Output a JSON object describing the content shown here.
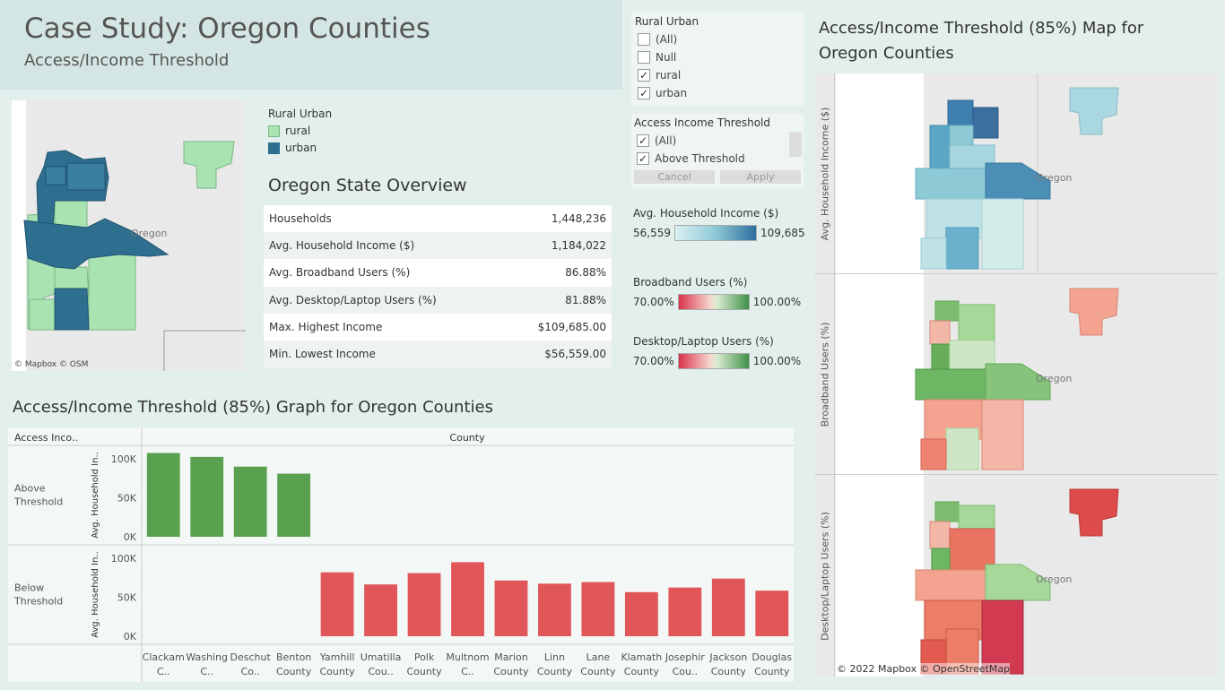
{
  "header": {
    "title": "Case Study: Oregon Counties",
    "subtitle": "Access/Income Threshold"
  },
  "small_map": {
    "state_label": "Oregon",
    "attribution": "© Mapbox  © OSM"
  },
  "legend": {
    "title": "Rural Urban",
    "items": [
      {
        "label": "rural",
        "color": "#a8e3b1"
      },
      {
        "label": "urban",
        "color": "#2e6e8e"
      }
    ]
  },
  "overview": {
    "title": "Oregon State Overview",
    "rows": [
      {
        "label": "Households",
        "value": "1,448,236"
      },
      {
        "label": "Avg. Household Income ($)",
        "value": "1,184,022"
      },
      {
        "label": "Avg. Broadband Users (%)",
        "value": "86.88%"
      },
      {
        "label": "Avg. Desktop/Laptop Users (%)",
        "value": "81.88%"
      },
      {
        "label": "Max. Highest Income",
        "value": "$109,685.00"
      },
      {
        "label": "Min. Lowest Income",
        "value": "$56,559.00"
      }
    ]
  },
  "filter_rural": {
    "title": "Rural Urban",
    "items": [
      {
        "label": "(All)",
        "checked": false
      },
      {
        "label": "Null",
        "checked": false
      },
      {
        "label": "rural",
        "checked": true
      },
      {
        "label": "urban",
        "checked": true
      }
    ]
  },
  "filter_access": {
    "title": "Access Income Threshold",
    "items": [
      {
        "label": "(All)",
        "checked": true
      },
      {
        "label": "Above Threshold",
        "checked": true
      }
    ],
    "cancel_label": "Cancel",
    "apply_label": "Apply"
  },
  "color_legends": {
    "income": {
      "title": "Avg. Household Income ($)",
      "min": "56,559",
      "max": "109,685"
    },
    "broadband": {
      "title": "Broadband Users (%)",
      "min": "70.00%",
      "max": "100.00%"
    },
    "desktop": {
      "title": "Desktop/Laptop Users (%)",
      "min": "70.00%",
      "max": "100.00%"
    }
  },
  "right_panel": {
    "title": "Access/Income Threshold (85%) Map for Oregon Counties",
    "panels": [
      {
        "axis": "Avg. Household Income ($)",
        "state_label": "Oregon"
      },
      {
        "axis": "Broadband Users (%)",
        "state_label": "Oregon"
      },
      {
        "axis": "Desktop/Laptop Users (%)",
        "state_label": "Oregon"
      }
    ],
    "attribution": "© 2022 Mapbox  © OpenStreetMap"
  },
  "graph": {
    "title": "Access/Income Threshold (85%) Graph for Oregon Counties",
    "row_header": "Access Inco..",
    "col_header": "County"
  },
  "chart_data": {
    "type": "bar",
    "title": "Access/Income Threshold (85%) Graph for Oregon Counties",
    "ylabel": "Avg. Household In..",
    "ylim": [
      0,
      115000
    ],
    "yticks": [
      "100K",
      "50K",
      "0K"
    ],
    "categories": [
      "Clackam C..",
      "Washing C..",
      "Deschut Co..",
      "Benton County",
      "Yamhill County",
      "Umatilla Cou..",
      "Polk County",
      "Multnom C..",
      "Marion County",
      "Linn County",
      "Lane County",
      "Klamath County",
      "Josephir Cou..",
      "Jackson County",
      "Douglas County"
    ],
    "series": [
      {
        "name": "Above Threshold",
        "color": "#59a14f",
        "values": [
          107500,
          102500,
          90000,
          81000,
          null,
          null,
          null,
          null,
          null,
          null,
          null,
          null,
          null,
          null,
          null
        ]
      },
      {
        "name": "Below Threshold",
        "color": "#e15759",
        "values": [
          null,
          null,
          null,
          null,
          82000,
          66500,
          81000,
          95000,
          71500,
          67500,
          69500,
          56600,
          62500,
          74000,
          58500
        ]
      }
    ]
  }
}
